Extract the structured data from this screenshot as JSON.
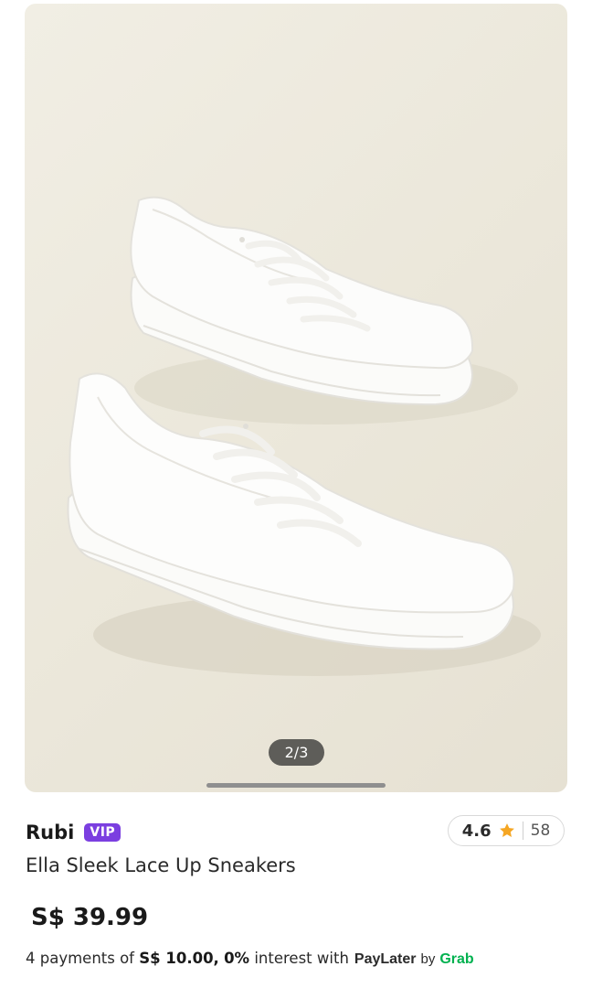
{
  "gallery": {
    "image_alt": "Ella Sleek Lace Up Sneakers",
    "page_indicator": "2/3",
    "current_page": 2,
    "total_pages": 3
  },
  "seller": {
    "name": "Rubi",
    "badge": "VIP"
  },
  "rating": {
    "score": "4.6",
    "count": "58",
    "icon": "star-icon",
    "star_color": "#f5a623"
  },
  "product": {
    "title": "Ella Sleek Lace Up Sneakers",
    "price": "S$ 39.99"
  },
  "installment": {
    "prefix": "4 payments of",
    "amount": "S$ 10.00,",
    "interest": "0%",
    "suffix": "interest with",
    "provider": "PayLater",
    "provider_by": "by",
    "provider_brand": "Grab"
  },
  "colors": {
    "vip_badge": "#7b3fe0",
    "grab_green": "#00b14f"
  }
}
